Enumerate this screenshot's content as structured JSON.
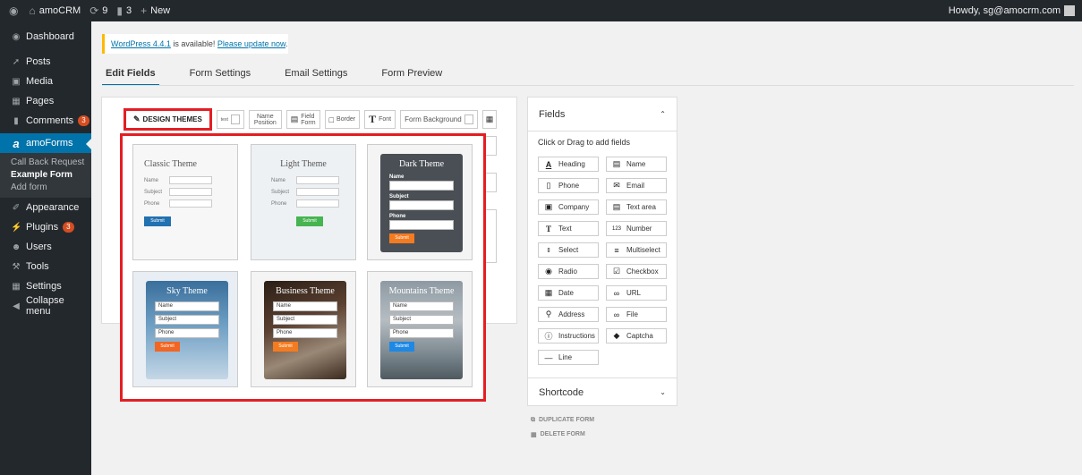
{
  "adminbar": {
    "wp_icon": "wordpress-logo-icon",
    "site_name": "amoCRM",
    "updates_count": "9",
    "comments_count": "3",
    "new_label": "New",
    "howdy": "Howdy, sg@amocrm.com"
  },
  "sidebar": {
    "dashboard": "Dashboard",
    "posts": "Posts",
    "media": "Media",
    "pages": "Pages",
    "comments": "Comments",
    "comments_badge": "3",
    "amoforms": "amoForms",
    "sub": [
      "Call Back Request",
      "Example Form",
      "Add form"
    ],
    "appearance": "Appearance",
    "plugins": "Plugins",
    "plugins_badge": "3",
    "users": "Users",
    "tools": "Tools",
    "settings": "Settings",
    "collapse": "Collapse menu"
  },
  "notice": {
    "text": "WordPress 4.4.1",
    "middle": " is available! ",
    "link": "Please update now",
    "end": "."
  },
  "tabs": [
    "Edit Fields",
    "Form Settings",
    "Email Settings",
    "Form Preview"
  ],
  "toolbar": {
    "design_themes": "DESIGN THEMES",
    "text_icon": "text",
    "name_position": [
      "Name",
      "Position"
    ],
    "field_form": [
      "Field",
      "Form"
    ],
    "border": "Border",
    "font": "Font",
    "font_glyph": "T",
    "form_background": "Form Background"
  },
  "themes": {
    "classic": {
      "title": "Classic Theme",
      "name": "Name",
      "subject": "Subject",
      "phone": "Phone",
      "submit": "Submit"
    },
    "light": {
      "title": "Light Theme",
      "name": "Name",
      "subject": "Subject",
      "phone": "Phone",
      "submit": "Submit"
    },
    "dark": {
      "title": "Dark Theme",
      "name": "Name",
      "subject": "Subject",
      "phone": "Phone",
      "submit": "Submit"
    },
    "sky": {
      "title": "Sky Theme",
      "name": "Name",
      "subject": "Subject",
      "phone": "Phone",
      "submit": "Submit"
    },
    "business": {
      "title": "Business Theme",
      "name": "Name",
      "subject": "Subject",
      "phone": "Phone",
      "submit": "Submit"
    },
    "mountains": {
      "title": "Mountains Theme",
      "name": "Name",
      "subject": "Subject",
      "phone": "Phone",
      "submit": "Submit"
    }
  },
  "fields_panel": {
    "title": "Fields",
    "hint": "Click or Drag to add fields",
    "items": [
      "Heading",
      "Name",
      "Phone",
      "Email",
      "Company",
      "Text area",
      "Text",
      "Number",
      "Select",
      "Multiselect",
      "Radio",
      "Checkbox",
      "Date",
      "URL",
      "Address",
      "File",
      "Instructions",
      "Captcha",
      "Line"
    ],
    "shortcode": "Shortcode"
  },
  "actions": {
    "duplicate": "DUPLICATE FORM",
    "delete": "DELETE FORM"
  },
  "colors": {
    "highlight": "#e31e24",
    "wp_blue": "#0073aa",
    "admin_dark": "#23282d"
  }
}
